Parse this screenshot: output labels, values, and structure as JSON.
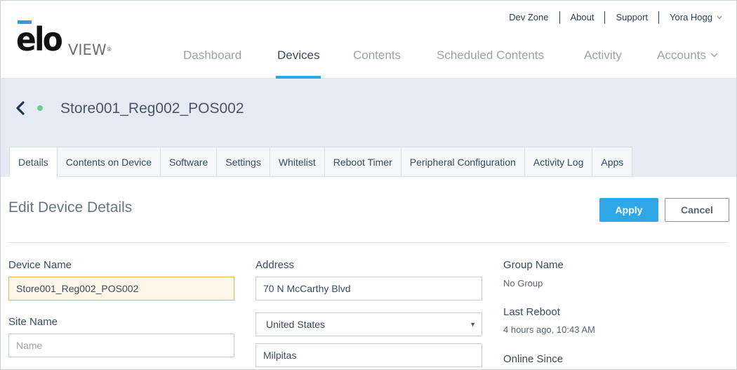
{
  "brand": {
    "logo_main": "elo",
    "logo_sub": "VIEW",
    "logo_tm": "®"
  },
  "util_nav": {
    "dev_zone": "Dev Zone",
    "about": "About",
    "support": "Support",
    "user": "Yora Hogg"
  },
  "main_nav": {
    "dashboard": "Dashboard",
    "devices": "Devices",
    "contents": "Contents",
    "scheduled": "Scheduled Contents",
    "activity": "Activity",
    "accounts": "Accounts"
  },
  "device": {
    "name": "Store001_Reg002_POS002",
    "status": "online"
  },
  "tabs": {
    "details": "Details",
    "contents_on_device": "Contents on Device",
    "software": "Software",
    "settings": "Settings",
    "whitelist": "Whitelist",
    "reboot_timer": "Reboot Timer",
    "peripheral": "Peripheral Configuration",
    "activity_log": "Activity Log",
    "apps": "Apps"
  },
  "form": {
    "title": "Edit Device Details",
    "apply": "Apply",
    "cancel": "Cancel",
    "device_name_label": "Device Name",
    "device_name_value": "Store001_Reg002_POS002",
    "site_name_label": "Site Name",
    "site_name_placeholder": "Name",
    "address_label": "Address",
    "address_value": "70 N McCarthy Blvd",
    "country_value": "United States",
    "city_value": "Milpitas",
    "group_name_label": "Group Name",
    "group_name_value": "No Group",
    "last_reboot_label": "Last Reboot",
    "last_reboot_value": "4 hours ago, 10:43 AM",
    "online_since_label": "Online Since"
  },
  "colors": {
    "accent": "#2fa6e6",
    "band_bg": "#e6ebf3",
    "status_online": "#6ccb8f",
    "highlight_field": "#fdf6e9"
  },
  "icons": {
    "back": "chevron-left-icon",
    "status": "status-dot-icon",
    "dropdown": "chevron-down-icon",
    "select": "caret-down-icon"
  }
}
